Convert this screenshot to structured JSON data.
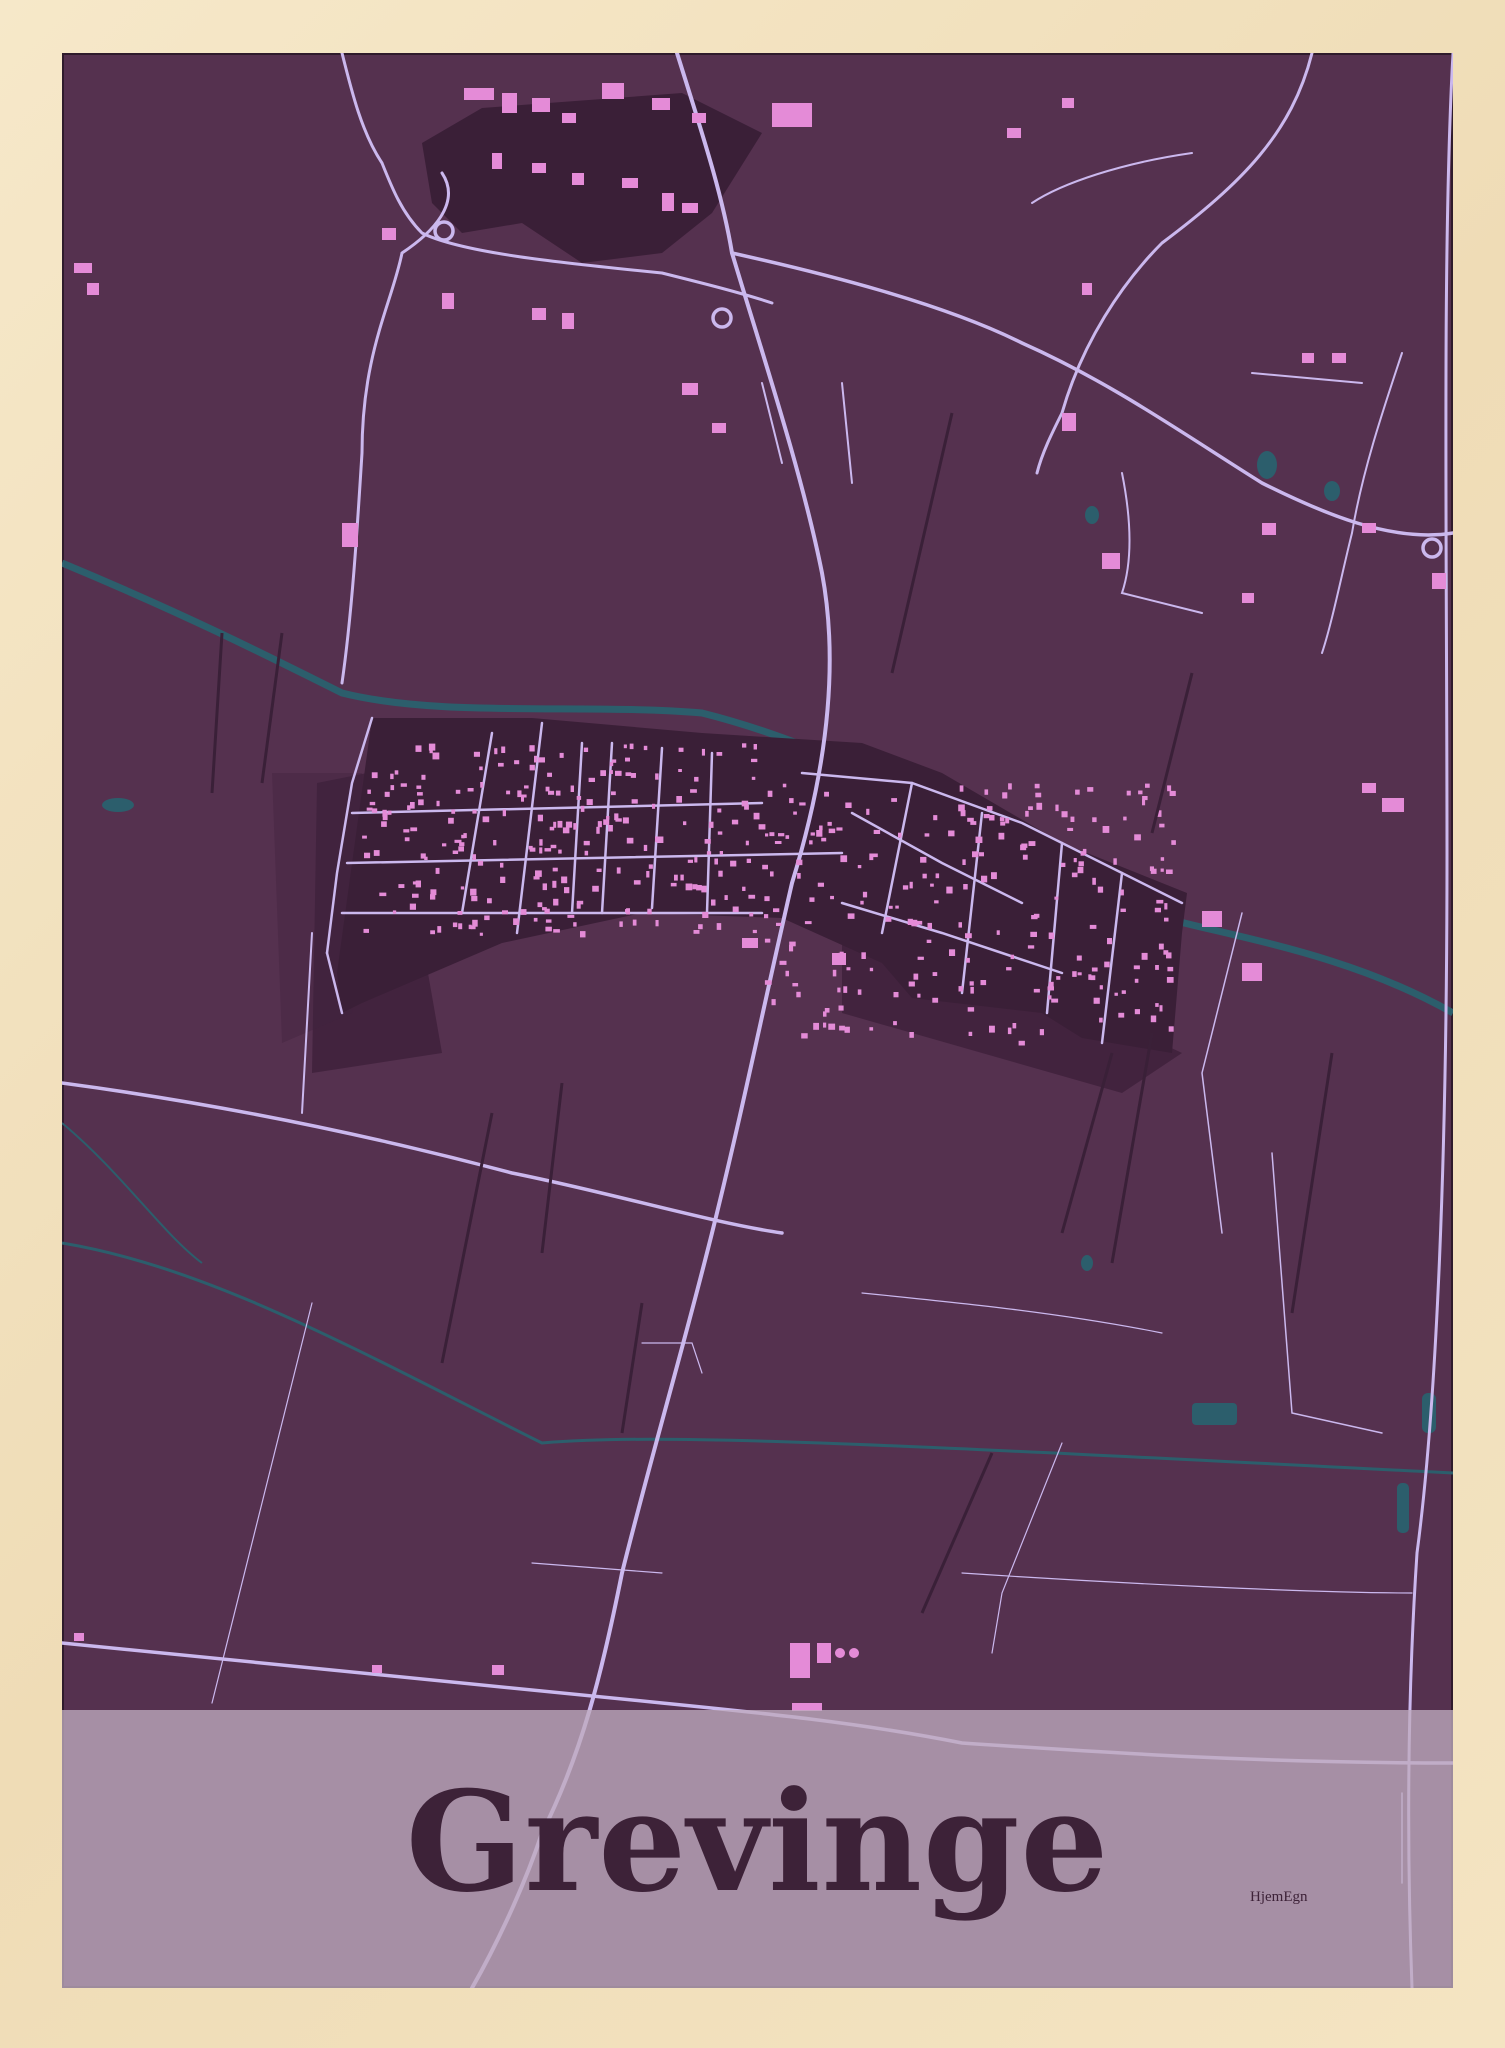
{
  "poster": {
    "title": "Grevinge",
    "brand": "HjemEgn"
  },
  "colors": {
    "frame": "#f1e0bd",
    "land": "#55314f",
    "roads": "#cbb8ee",
    "buildings": "#e48bd7",
    "water": "#2c5e6c",
    "title_band": "#bfaabe",
    "title_text": "#3d2238"
  }
}
